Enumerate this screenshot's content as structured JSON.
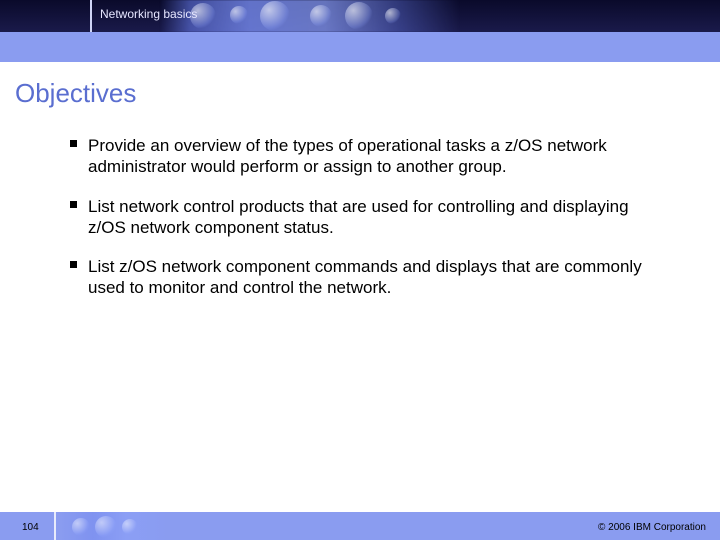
{
  "header": {
    "title": "Networking basics"
  },
  "heading": "Objectives",
  "bullets": [
    "Provide an overview of the types of operational tasks a z/OS network administrator would perform or assign to another group.",
    "List network control products that are used for controlling and displaying z/OS network component status.",
    "List z/OS network component commands and displays that are commonly used to monitor and control the network."
  ],
  "footer": {
    "page": "104",
    "copyright": "© 2006 IBM Corporation"
  },
  "colors": {
    "accent": "#8a9cf0",
    "heading": "#5a6ed0",
    "header_dark": "#0a0a2a"
  }
}
